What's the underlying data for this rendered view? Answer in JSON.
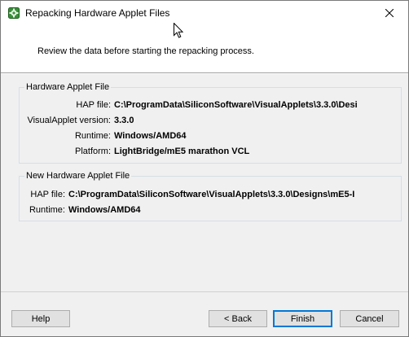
{
  "window": {
    "title": "Repacking Hardware Applet Files",
    "app_icon": "applet-gear-icon",
    "close_icon": "close-icon"
  },
  "header": {
    "subtitle": "Review the data before starting the repacking process."
  },
  "hardware_applet_file": {
    "legend": "Hardware Applet File",
    "rows": [
      {
        "label": "HAP file:",
        "value": "C:\\ProgramData\\SiliconSoftware\\VisualApplets\\3.3.0\\Desi"
      },
      {
        "label": "VisualApplet version:",
        "value": "3.3.0"
      },
      {
        "label": "Runtime:",
        "value": "Windows/AMD64"
      },
      {
        "label": "Platform:",
        "value": "LightBridge/mE5 marathon VCL"
      }
    ]
  },
  "new_hardware_applet_file": {
    "legend": "New Hardware Applet File",
    "rows": [
      {
        "label": "HAP file:",
        "value": "C:\\ProgramData\\SiliconSoftware\\VisualApplets\\3.3.0\\Designs\\mE5-I"
      },
      {
        "label": "Runtime:",
        "value": "Windows/AMD64"
      }
    ]
  },
  "buttons": {
    "help": "Help",
    "back": "< Back",
    "finish": "Finish",
    "cancel": "Cancel"
  },
  "colors": {
    "default_button_border": "#0078d7",
    "group_border": "#d5dfe5",
    "dialog_background": "#f0f0f0"
  }
}
